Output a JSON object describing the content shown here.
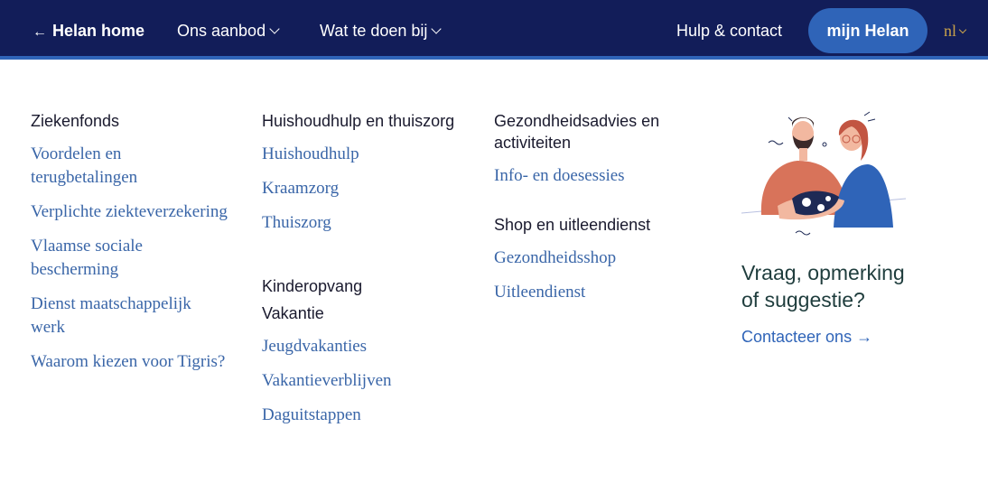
{
  "topbar": {
    "home_arrow": "←",
    "home_label": "Helan home",
    "nav": [
      {
        "label": "Ons aanbod"
      },
      {
        "label": "Wat te doen bij"
      }
    ],
    "help_label": "Hulp & contact",
    "account_button": "mijn Helan",
    "language": "nl"
  },
  "columns": {
    "col1": {
      "heading": "Ziekenfonds",
      "links": [
        "Voordelen en terugbetalingen",
        "Verplichte ziekteverzekering",
        "Vlaamse sociale bescherming",
        "Dienst maatschappelijk werk",
        "Waarom kiezen voor Tigris?"
      ]
    },
    "col2": {
      "heading": "Huishoudhulp en thuiszorg",
      "links": [
        "Huishoudhulp",
        "Kraamzorg",
        "Thuiszorg"
      ],
      "heading2": "Kinderopvang",
      "heading3": "Vakantie",
      "links3": [
        "Jeugdvakanties",
        "Vakantieverblijven",
        "Daguitstappen"
      ]
    },
    "col3": {
      "heading": "Gezondheidsadvies en activiteiten",
      "links": [
        "Info- en doesessies"
      ],
      "heading2": "Shop en uitleendienst",
      "links2": [
        "Gezondheidsshop",
        "Uitleendienst"
      ]
    },
    "col4": {
      "cta_title": "Vraag, opmerking of suggestie?",
      "cta_link": "Contacteer ons →"
    }
  },
  "colors": {
    "topbar_bg": "#121d59",
    "accent": "#2f64b8",
    "link": "#3a66a8",
    "lang": "#c9a24a"
  }
}
